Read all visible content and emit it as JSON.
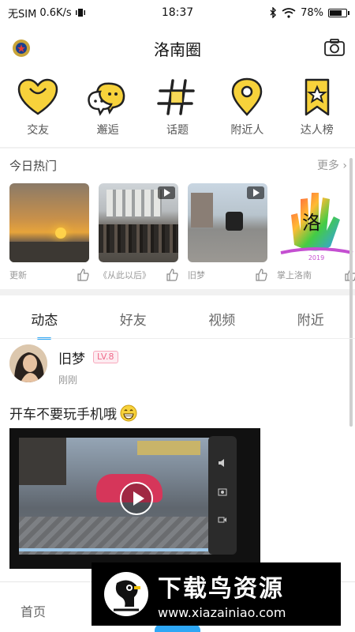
{
  "status_bar": {
    "carrier": "无SIM",
    "speed": "0.6K/s",
    "time": "18:37",
    "battery": "78%"
  },
  "header": {
    "title": "洛南圈"
  },
  "categories": [
    {
      "label": "交友",
      "icon": "heart-icon"
    },
    {
      "label": "邂逅",
      "icon": "chat-bubbles-icon"
    },
    {
      "label": "话题",
      "icon": "hashtag-icon"
    },
    {
      "label": "附近人",
      "icon": "location-pin-icon"
    },
    {
      "label": "达人榜",
      "icon": "star-ribbon-icon"
    }
  ],
  "hot": {
    "title": "今日热门",
    "more": "更多",
    "items": [
      {
        "caption": "更新"
      },
      {
        "caption": "《从此以后》"
      },
      {
        "caption": "旧梦"
      },
      {
        "caption": "掌上洛南"
      }
    ],
    "brand_thumb_year": "2019",
    "brand_thumb_char": "洛"
  },
  "tabs": [
    "动态",
    "好友",
    "视频",
    "附近"
  ],
  "post": {
    "username": "旧梦",
    "level": "LV.8",
    "time": "刚刚",
    "text": "开车不要玩手机哦"
  },
  "bottom_nav": {
    "home": "首页"
  },
  "watermark": {
    "title": "下载鸟资源",
    "url": "www.xiazainiao.com"
  },
  "colors": {
    "accent_yellow": "#f7d23b",
    "accent_blue": "#2ea7f5",
    "level_pink": "#f06a8a"
  }
}
